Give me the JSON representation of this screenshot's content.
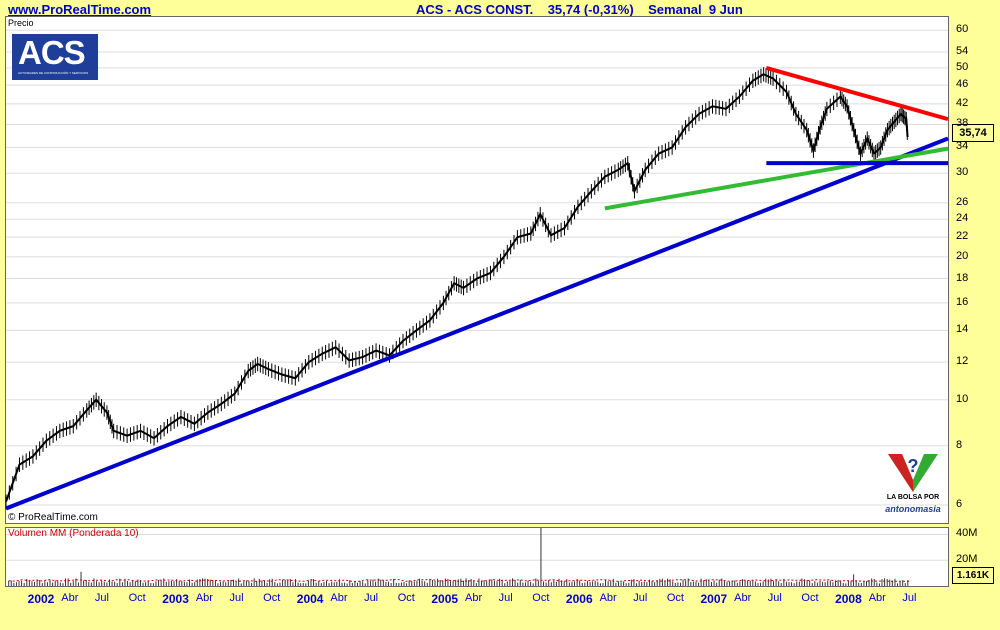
{
  "header": {
    "site": "www.ProRealTime.com",
    "title": "ACS - ACS CONST.    35,74 (-0,31%)    Semanal  9 Jun"
  },
  "main_panel": {
    "label": "Precio",
    "copyright": "© ProRealTime.com",
    "price_tag": "35,74"
  },
  "logo": {
    "text": "ACS",
    "sub": "ACTIVIDADES DE CONSTRUCCIÓN Y SERVICIOS"
  },
  "badge": {
    "line1": "LA BOLSA POR",
    "line2": "antonomasia"
  },
  "volume_panel": {
    "label": "Volumen MM (Ponderada 10)",
    "tag": "1.161K",
    "y_labels": [
      "40M",
      "20M"
    ]
  },
  "colors": {
    "background": "#FFFF99",
    "axis_text": "#0000CC",
    "support": "#0000CC",
    "resistance": "#FF0000",
    "trend2": "#33BB33",
    "candles": "#000000"
  },
  "chart_data": {
    "type": "line",
    "title": "ACS - ACS CONST. 35,74 (-0,31%) Semanal 9 Jun",
    "y_scale": "log",
    "ylim": [
      5.5,
      64
    ],
    "y_ticks": [
      6,
      8,
      10,
      12,
      14,
      16,
      18,
      20,
      22,
      24,
      26,
      30,
      34,
      38,
      42,
      46,
      50,
      54,
      60
    ],
    "x_ticks": [
      "2002",
      "Abr",
      "Jul",
      "Oct",
      "2003",
      "Abr",
      "Jul",
      "Oct",
      "2004",
      "Abr",
      "Jul",
      "Oct",
      "2005",
      "Abr",
      "Jul",
      "Oct",
      "2006",
      "Abr",
      "Jul",
      "Oct",
      "2007",
      "Abr",
      "Jul",
      "Oct",
      "2008",
      "Abr",
      "Jul"
    ],
    "x_start": 2001.75,
    "x_end": 2008.75,
    "series": [
      {
        "values": [
          [
            2001.75,
            6.1
          ],
          [
            2001.85,
            7.3
          ],
          [
            2001.95,
            7.6
          ],
          [
            2002.05,
            8.2
          ],
          [
            2002.15,
            8.6
          ],
          [
            2002.25,
            8.8
          ],
          [
            2002.35,
            9.5
          ],
          [
            2002.42,
            10.0
          ],
          [
            2002.5,
            9.4
          ],
          [
            2002.55,
            8.6
          ],
          [
            2002.65,
            8.4
          ],
          [
            2002.75,
            8.6
          ],
          [
            2002.85,
            8.3
          ],
          [
            2002.95,
            8.8
          ],
          [
            2003.05,
            9.2
          ],
          [
            2003.15,
            8.9
          ],
          [
            2003.25,
            9.4
          ],
          [
            2003.35,
            9.8
          ],
          [
            2003.45,
            10.3
          ],
          [
            2003.55,
            11.5
          ],
          [
            2003.62,
            11.9
          ],
          [
            2003.7,
            11.6
          ],
          [
            2003.8,
            11.3
          ],
          [
            2003.9,
            11.1
          ],
          [
            2004.0,
            12.0
          ],
          [
            2004.1,
            12.5
          ],
          [
            2004.2,
            12.9
          ],
          [
            2004.3,
            12.1
          ],
          [
            2004.4,
            12.3
          ],
          [
            2004.5,
            12.7
          ],
          [
            2004.6,
            12.4
          ],
          [
            2004.7,
            13.3
          ],
          [
            2004.8,
            14.0
          ],
          [
            2004.9,
            14.7
          ],
          [
            2005.0,
            16.0
          ],
          [
            2005.08,
            17.6
          ],
          [
            2005.15,
            17.2
          ],
          [
            2005.25,
            18.0
          ],
          [
            2005.35,
            18.5
          ],
          [
            2005.45,
            20.0
          ],
          [
            2005.55,
            22.0
          ],
          [
            2005.65,
            22.4
          ],
          [
            2005.72,
            24.6
          ],
          [
            2005.8,
            22.2
          ],
          [
            2005.9,
            23.0
          ],
          [
            2006.0,
            25.5
          ],
          [
            2006.1,
            27.5
          ],
          [
            2006.2,
            29.5
          ],
          [
            2006.3,
            30.5
          ],
          [
            2006.37,
            31.5
          ],
          [
            2006.42,
            27.5
          ],
          [
            2006.5,
            30.5
          ],
          [
            2006.6,
            33.0
          ],
          [
            2006.7,
            34.0
          ],
          [
            2006.8,
            37.5
          ],
          [
            2006.9,
            40.0
          ],
          [
            2007.0,
            41.5
          ],
          [
            2007.1,
            41.0
          ],
          [
            2007.2,
            43.5
          ],
          [
            2007.3,
            47.0
          ],
          [
            2007.38,
            48.5
          ],
          [
            2007.45,
            47.5
          ],
          [
            2007.55,
            44.5
          ],
          [
            2007.62,
            40.0
          ],
          [
            2007.7,
            37.0
          ],
          [
            2007.75,
            33.5
          ],
          [
            2007.8,
            37.5
          ],
          [
            2007.85,
            41.0
          ],
          [
            2007.95,
            43.5
          ],
          [
            2008.0,
            41.5
          ],
          [
            2008.05,
            37.0
          ],
          [
            2008.1,
            33.0
          ],
          [
            2008.15,
            35.5
          ],
          [
            2008.2,
            33.0
          ],
          [
            2008.25,
            34.0
          ],
          [
            2008.3,
            37.0
          ],
          [
            2008.35,
            38.5
          ],
          [
            2008.4,
            40.0
          ],
          [
            2008.44,
            39.0
          ],
          [
            2008.45,
            35.74
          ]
        ]
      }
    ],
    "trendlines": [
      {
        "color": "#0000CC",
        "points": [
          [
            2001.75,
            5.9
          ],
          [
            2008.75,
            35.5
          ]
        ]
      },
      {
        "color": "#FF0000",
        "points": [
          [
            2007.4,
            50.0
          ],
          [
            2008.75,
            39.0
          ]
        ]
      },
      {
        "color": "#33BB33",
        "points": [
          [
            2006.2,
            25.3
          ],
          [
            2008.75,
            33.8
          ]
        ]
      },
      {
        "color": "#0000CC",
        "points": [
          [
            2007.4,
            31.5
          ],
          [
            2008.75,
            31.5
          ]
        ]
      }
    ],
    "volume": {
      "label": "Volumen MM (Ponderada 10)",
      "ylim": [
        0,
        45
      ],
      "y_ticks": [
        20,
        40
      ],
      "units": "M",
      "spikes": [
        [
          2002.3,
          11
        ],
        [
          2005.72,
          45
        ],
        [
          2008.05,
          9
        ]
      ],
      "last": "1.161K"
    }
  }
}
